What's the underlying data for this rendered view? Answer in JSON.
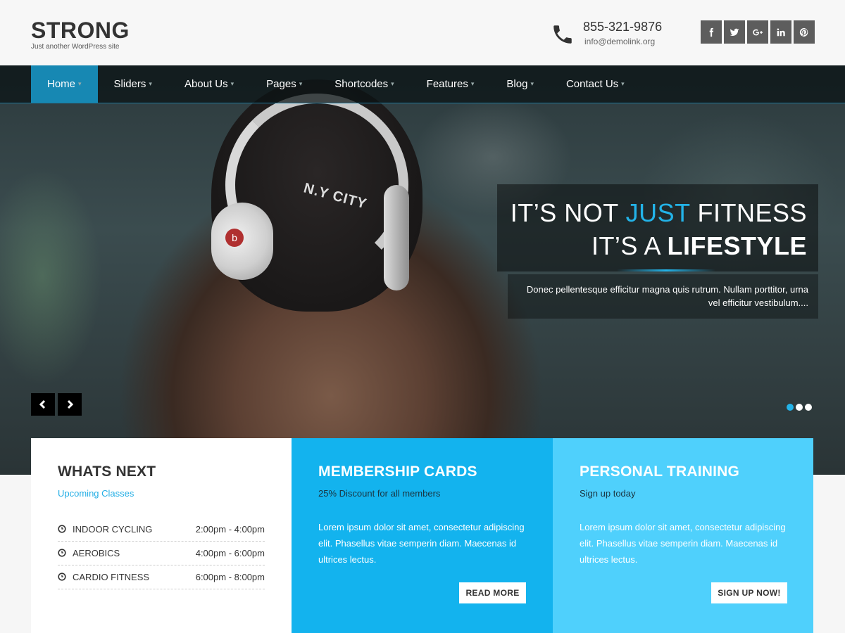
{
  "site": {
    "title": "STRONG",
    "tagline": "Just another WordPress site"
  },
  "contact": {
    "phone": "855-321-9876",
    "email": "info@demolink.org",
    "icon": "phone-icon"
  },
  "social": [
    {
      "name": "facebook-icon",
      "glyph": "f"
    },
    {
      "name": "twitter-icon",
      "glyph": "t"
    },
    {
      "name": "google-plus-icon",
      "glyph": "g+"
    },
    {
      "name": "linkedin-icon",
      "glyph": "in"
    },
    {
      "name": "pinterest-icon",
      "glyph": "p"
    }
  ],
  "nav": {
    "items": [
      {
        "label": "Home",
        "active": true
      },
      {
        "label": "Sliders"
      },
      {
        "label": "About Us"
      },
      {
        "label": "Pages"
      },
      {
        "label": "Shortcodes"
      },
      {
        "label": "Features"
      },
      {
        "label": "Blog"
      },
      {
        "label": "Contact Us"
      }
    ]
  },
  "hero": {
    "line1_a": "IT’S NOT ",
    "line1_highlight": "JUST",
    "line1_b": " FITNESS",
    "line2_a": "IT’S A ",
    "line2_bold": "LIFESTYLE",
    "description": "Donec pellentesque efficitur magna quis rutrum. Nullam porttitor, urna vel efficitur vestibulum....",
    "cap_text": "N.Y CITY",
    "headphone_logo": "b",
    "prev_icon": "chevron-left-icon",
    "next_icon": "chevron-right-icon",
    "slide_count": 3,
    "active_slide": 1
  },
  "panels": {
    "whats_next": {
      "title": "WHATS NEXT",
      "subtitle": "Upcoming Classes",
      "classes": [
        {
          "name": "INDOOR CYCLING",
          "time": "2:00pm - 4:00pm"
        },
        {
          "name": "AEROBICS",
          "time": "4:00pm - 6:00pm"
        },
        {
          "name": "CARDIO FITNESS",
          "time": "6:00pm - 8:00pm"
        }
      ]
    },
    "membership": {
      "title": "MEMBERSHIP CARDS",
      "subtitle": "25% Discount for all members",
      "text": "Lorem ipsum dolor sit amet, consectetur adipiscing elit. Phasellus vitae semperin diam. Maecenas id ultrices lectus.",
      "button": "READ MORE"
    },
    "training": {
      "title": "PERSONAL TRAINING",
      "subtitle": "Sign up today",
      "text": "Lorem ipsum dolor sit amet, consectetur adipiscing elit. Phasellus vitae semperin diam. Maecenas id ultrices lectus.",
      "button": "SIGN UP NOW!"
    }
  },
  "colors": {
    "accent": "#23b3e8",
    "nav_active": "#1788b3",
    "panel_blue": "#13b3ee",
    "panel_light_blue": "#4fd0fc",
    "social_bg": "#5d5d5d"
  }
}
